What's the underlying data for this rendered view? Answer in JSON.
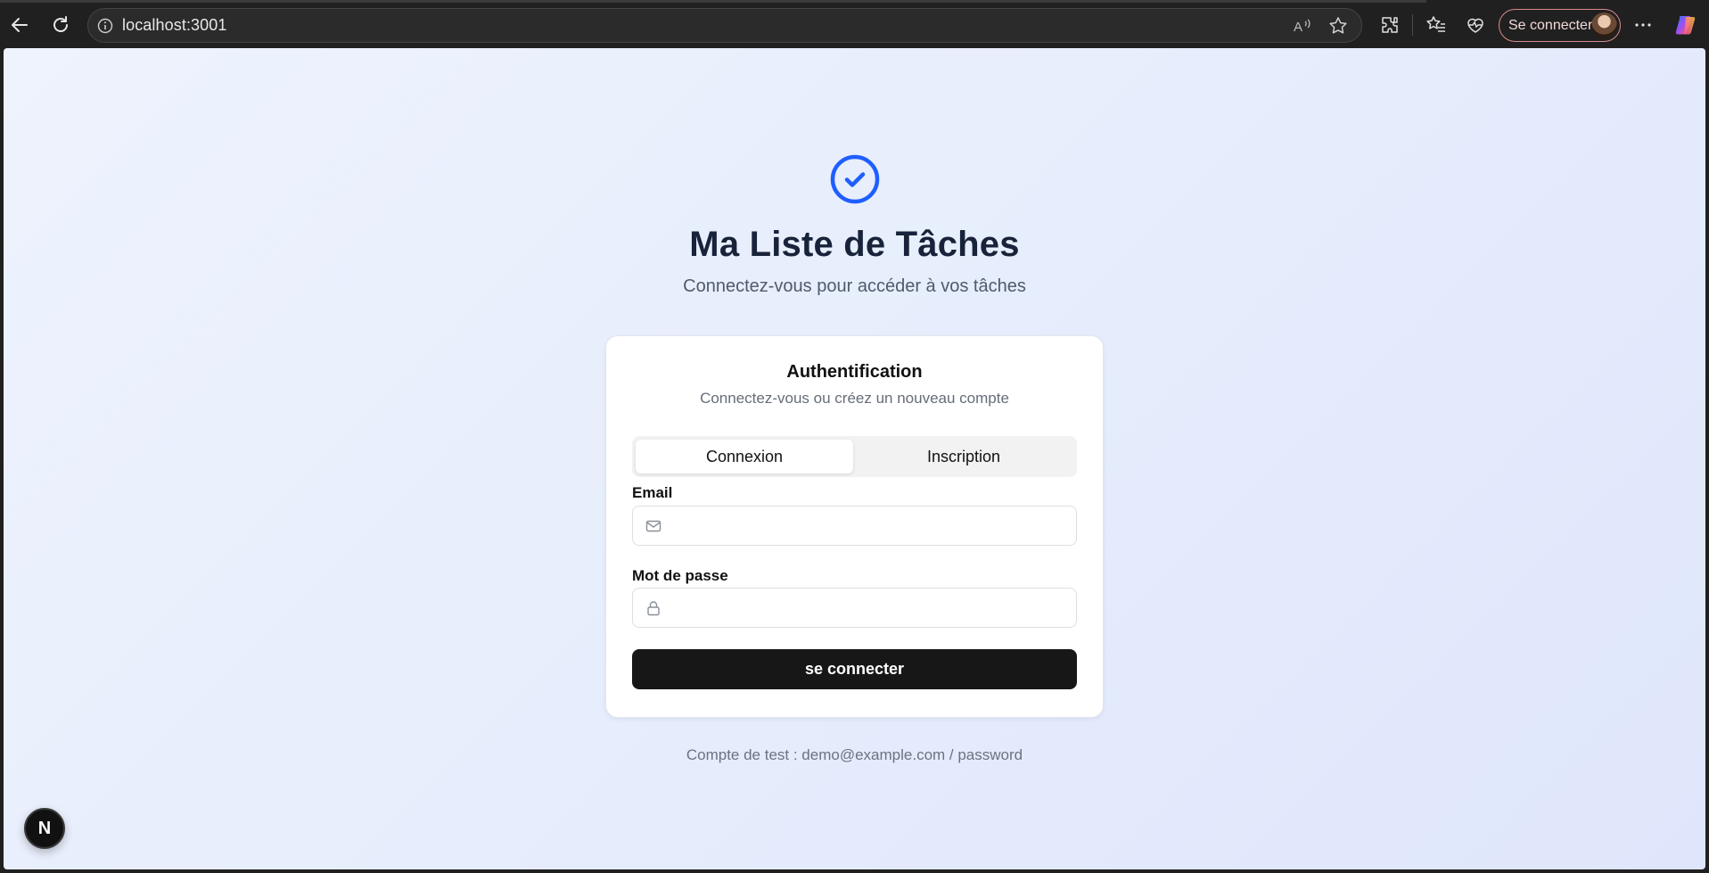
{
  "browser": {
    "url": "localhost:3001",
    "signin_label": "Se connecter",
    "icons": [
      "back-icon",
      "refresh-icon",
      "info-icon",
      "read-aloud-icon",
      "favorite-star-icon",
      "extensions-icon",
      "favorites-icon",
      "health-icon",
      "more-icon",
      "copilot-icon"
    ]
  },
  "app": {
    "title": "Ma Liste de Tâches",
    "subtitle": "Connectez-vous pour accéder à vos tâches",
    "accent_color": "#1f5eff",
    "card": {
      "title": "Authentification",
      "subtitle": "Connectez-vous ou créez un nouveau compte",
      "tabs": [
        {
          "label": "Connexion",
          "active": true
        },
        {
          "label": "Inscription",
          "active": false
        }
      ],
      "email_label": "Email",
      "email_value": "",
      "password_label": "Mot de passe",
      "password_value": "",
      "submit_label": "se connecter"
    },
    "footer_note": "Compte de test : demo@example.com / password"
  },
  "dev_badge": {
    "label": "N"
  }
}
